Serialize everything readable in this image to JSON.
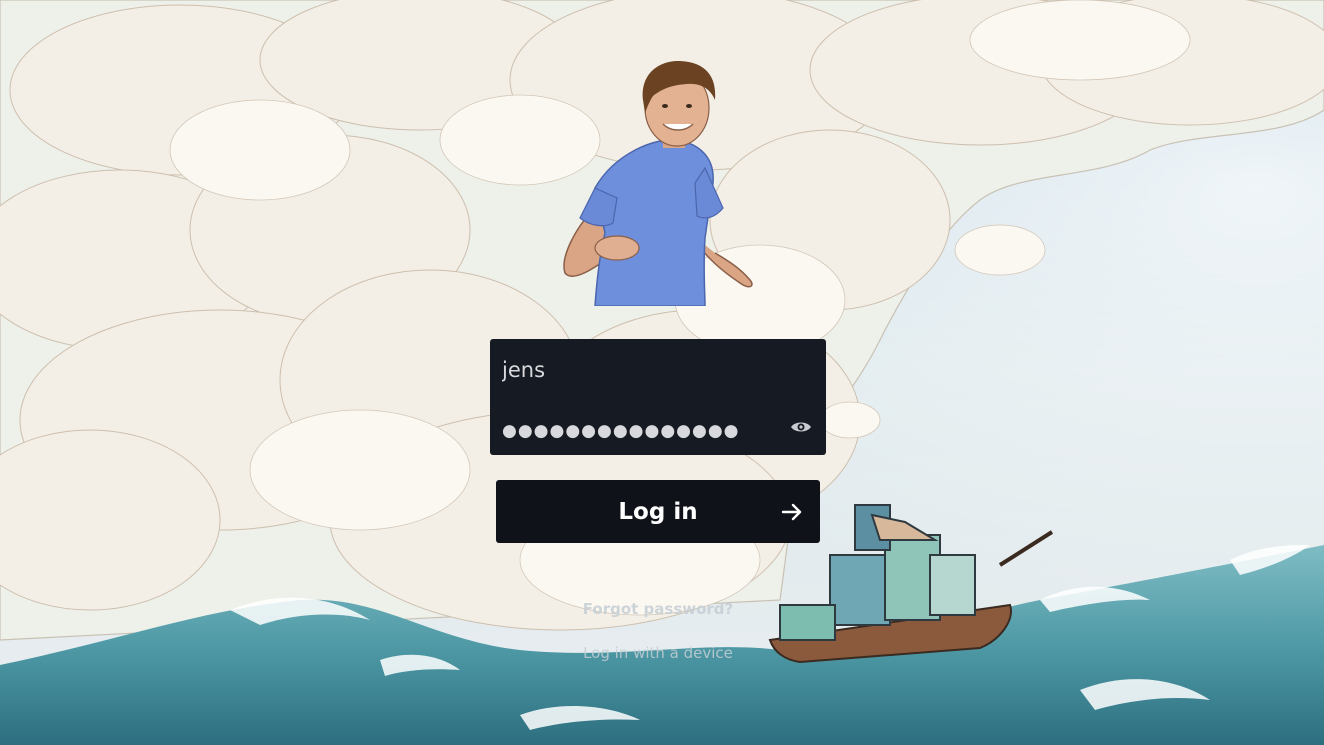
{
  "login": {
    "username_value": "jens",
    "password_mask": "●●●●●●●●●●●●●●●",
    "submit_label": "Log in"
  },
  "links": {
    "forgot_password": "Forgot password?",
    "device_login": "Log in with a device"
  },
  "icons": {
    "show_password": "eye-icon",
    "submit_arrow": "arrow-right-icon"
  },
  "colors": {
    "form_background": "#161a22",
    "button_background": "#0f1218",
    "text": "#d7d9dd"
  }
}
